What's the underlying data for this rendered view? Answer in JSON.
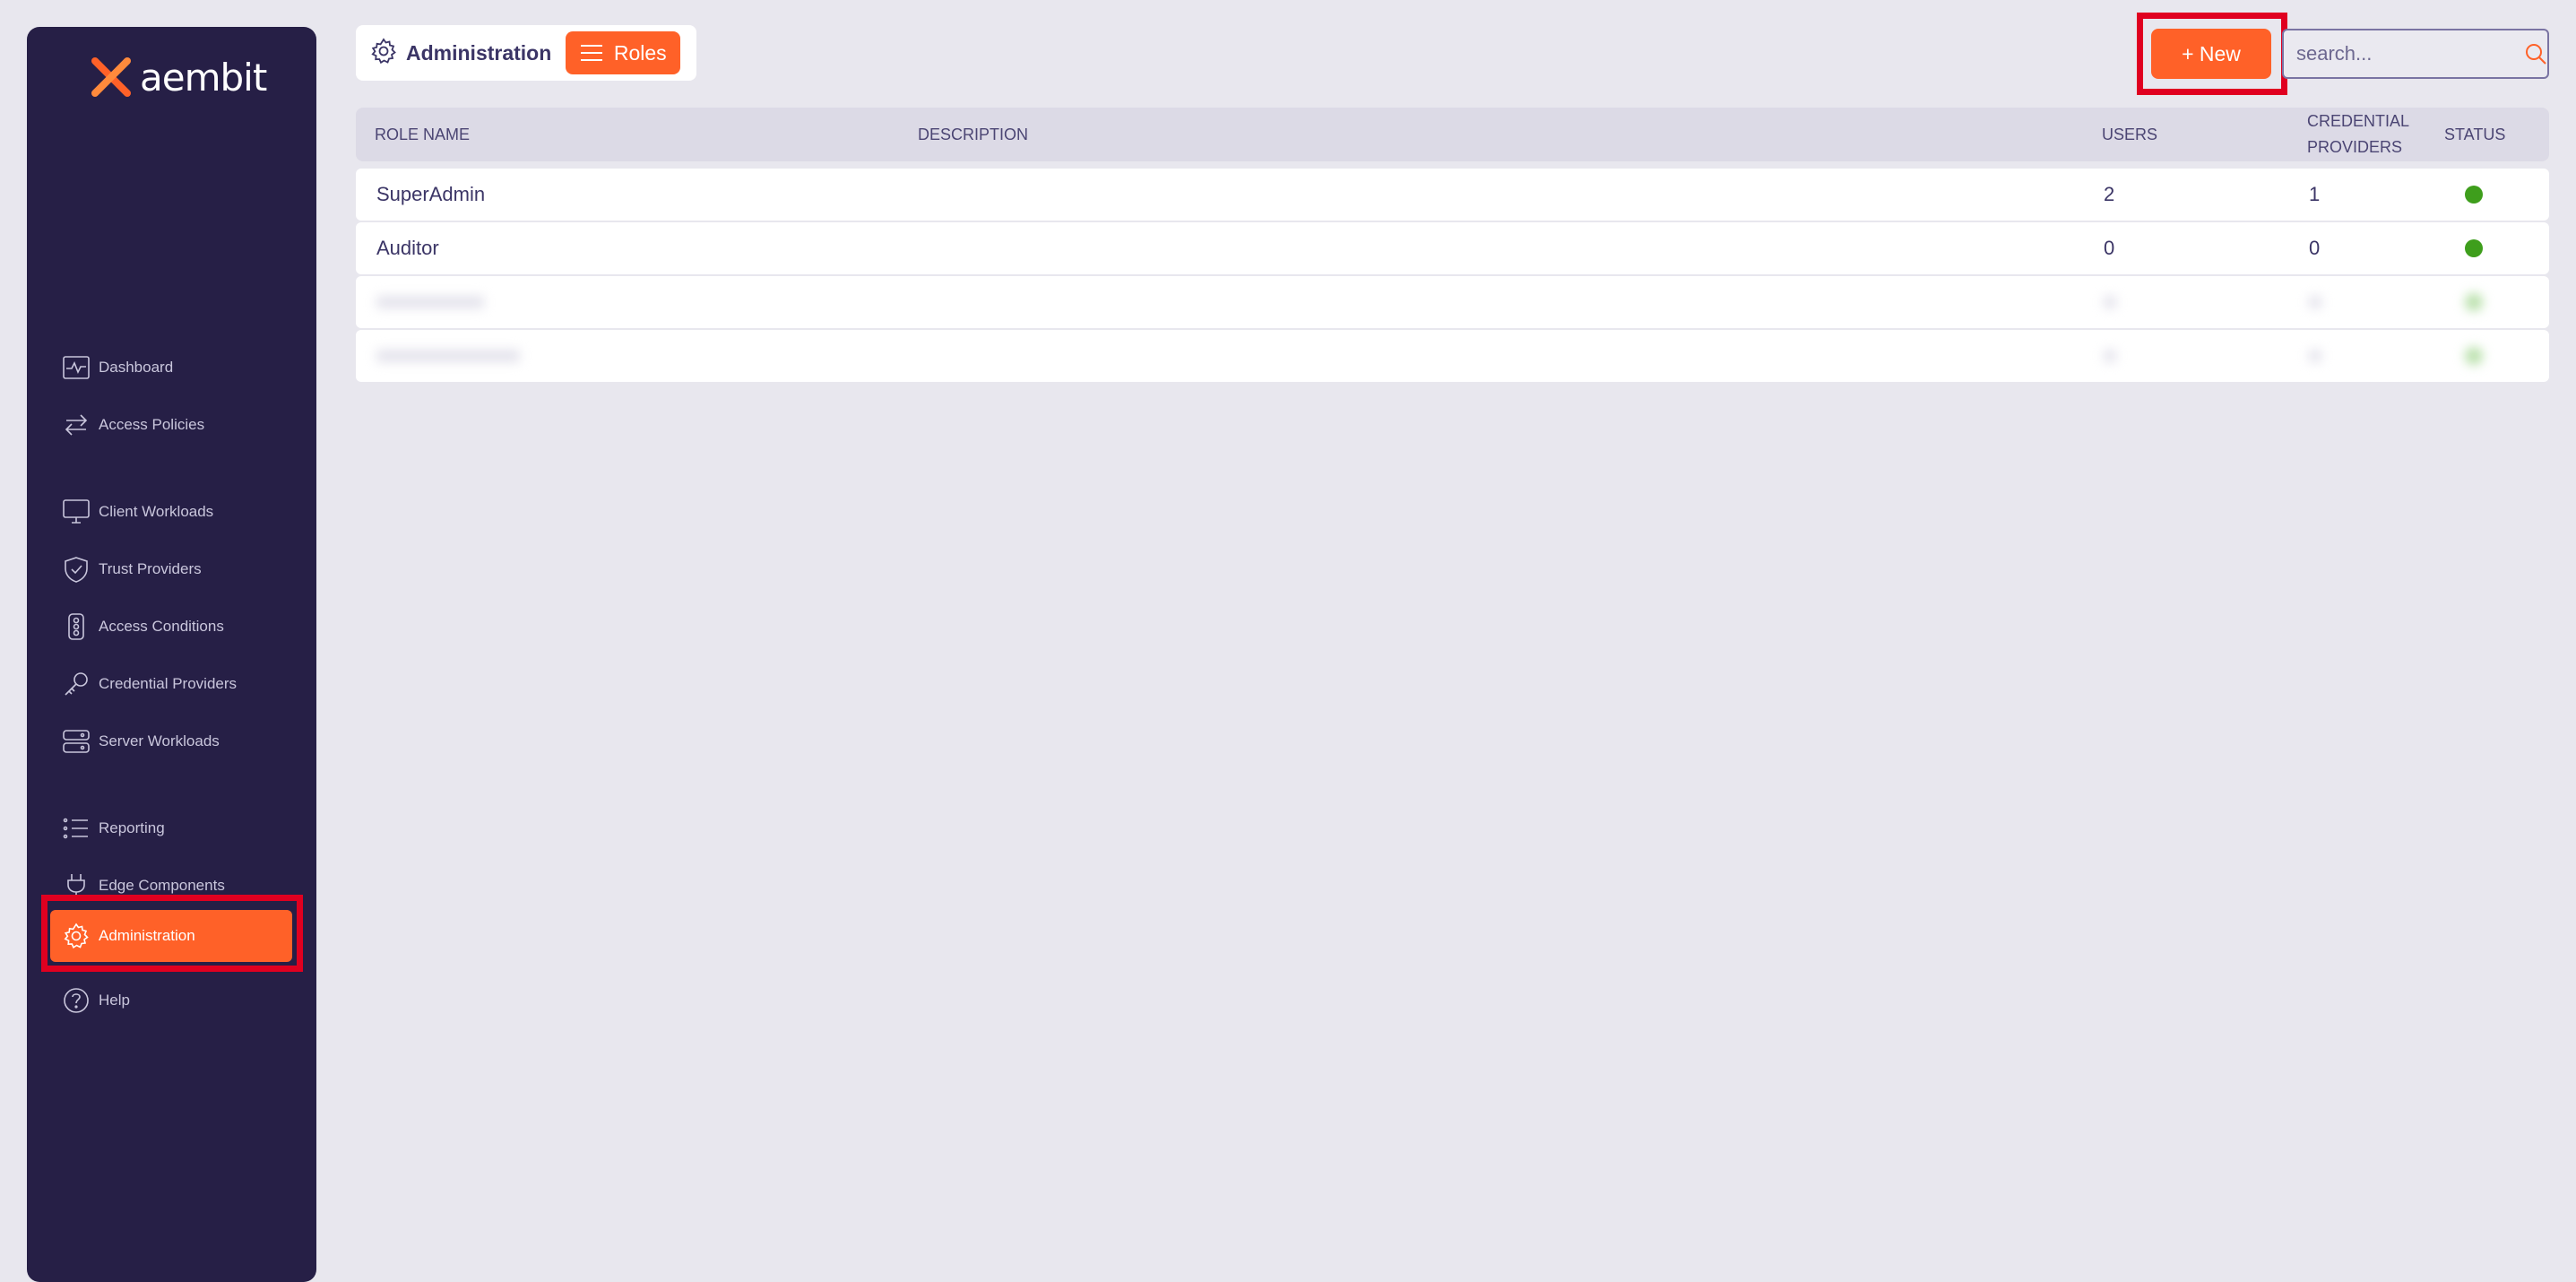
{
  "brand": {
    "name": "aembit",
    "accent": "#ff6128",
    "sidebar_bg": "#261f46",
    "status_active": "#3e9e1c"
  },
  "sidebar": {
    "items": [
      {
        "label": "Dashboard",
        "icon": "activity-icon"
      },
      {
        "label": "Access Policies",
        "icon": "arrows-exchange-icon"
      },
      {
        "label": "Client Workloads",
        "icon": "monitor-icon"
      },
      {
        "label": "Trust Providers",
        "icon": "shield-check-icon"
      },
      {
        "label": "Access Conditions",
        "icon": "traffic-light-icon"
      },
      {
        "label": "Credential Providers",
        "icon": "key-icon"
      },
      {
        "label": "Server Workloads",
        "icon": "server-icon"
      },
      {
        "label": "Reporting",
        "icon": "list-icon"
      },
      {
        "label": "Edge Components",
        "icon": "plug-icon"
      },
      {
        "label": "Administration",
        "icon": "gear-icon",
        "active": true
      },
      {
        "label": "Help",
        "icon": "help-circle-icon"
      }
    ]
  },
  "header": {
    "section": "Administration",
    "page_pill": "Roles",
    "new_button": "+ New",
    "search_placeholder": "search..."
  },
  "table": {
    "columns": {
      "role_name": "ROLE NAME",
      "description": "DESCRIPTION",
      "users": "USERS",
      "credential_providers": "CREDENTIAL PROVIDERS",
      "status": "STATUS"
    },
    "rows": [
      {
        "role_name": "SuperAdmin",
        "description": "",
        "users": "2",
        "credential_providers": "1",
        "status": "active"
      },
      {
        "role_name": "Auditor",
        "description": "",
        "users": "0",
        "credential_providers": "0",
        "status": "active"
      }
    ]
  }
}
